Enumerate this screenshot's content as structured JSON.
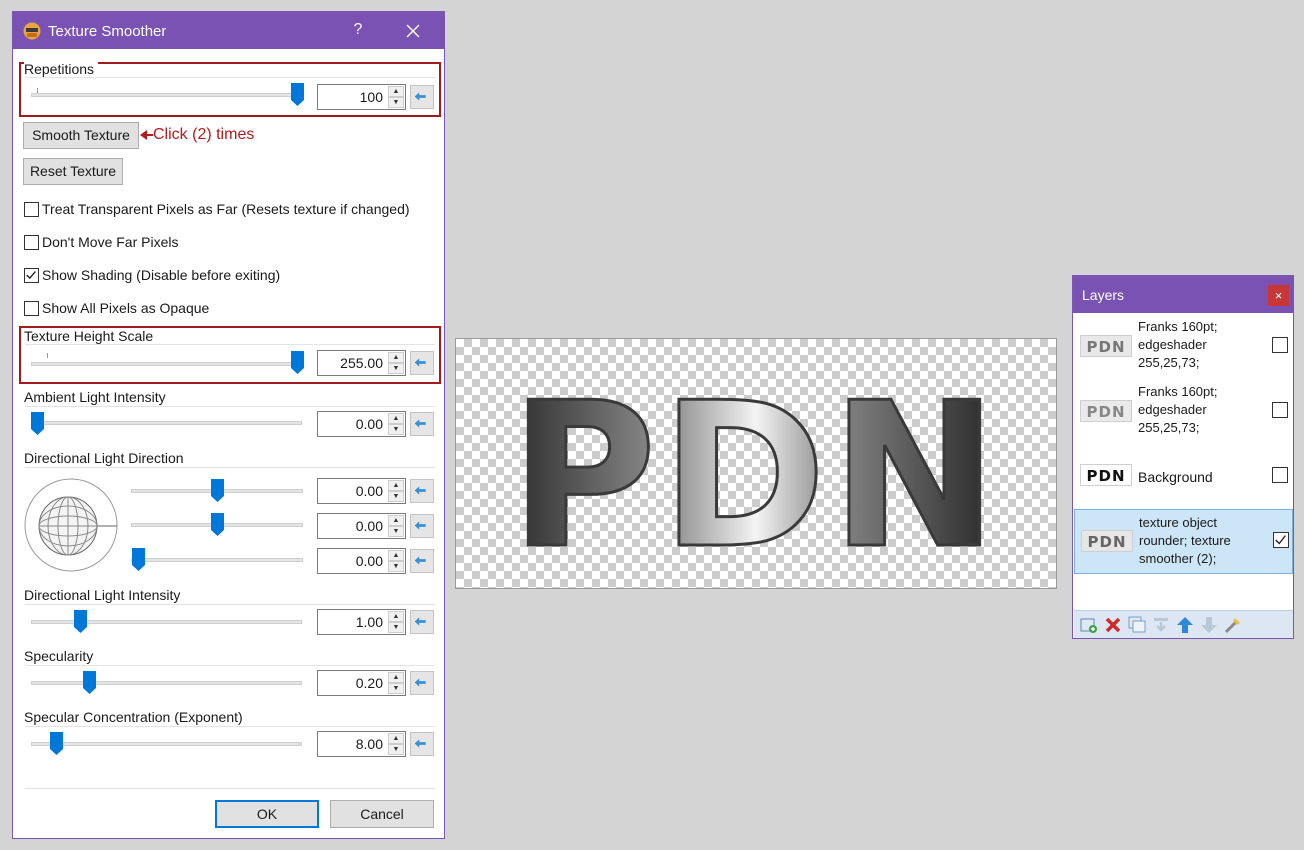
{
  "dialog": {
    "title": "Texture Smoother",
    "help_glyph": "?",
    "ok_label": "OK",
    "cancel_label": "Cancel"
  },
  "repetitions": {
    "label": "Repetitions",
    "value": "100",
    "slider_fraction": 1.0
  },
  "smooth_texture_label": "Smooth Texture",
  "annotation": "Click (2) times",
  "reset_texture_label": "Reset Texture",
  "checkboxes": [
    {
      "label": "Treat Transparent Pixels as Far (Resets texture if changed)",
      "checked": false
    },
    {
      "label": "Don't Move Far Pixels",
      "checked": false
    },
    {
      "label": "Show Shading (Disable before exiting)",
      "checked": true
    },
    {
      "label": "Show All Pixels as Opaque",
      "checked": false
    }
  ],
  "texture_height_scale": {
    "label": "Texture Height Scale",
    "value": "255.00",
    "slider_fraction": 1.0
  },
  "ambient_light": {
    "label": "Ambient Light Intensity",
    "value": "0.00",
    "slider_fraction": 0.0
  },
  "directional_light_direction": {
    "label": "Directional Light Direction",
    "values": [
      "0.00",
      "0.00",
      "0.00"
    ],
    "slider_fractions": [
      0.5,
      0.5,
      0.0
    ]
  },
  "directional_light_intensity": {
    "label": "Directional Light Intensity",
    "value": "1.00",
    "slider_fraction": 0.18
  },
  "specularity": {
    "label": "Specularity",
    "value": "0.20",
    "slider_fraction": 0.21
  },
  "specular_concentration": {
    "label": "Specular Concentration (Exponent)",
    "value": "8.00",
    "slider_fraction": 0.09
  },
  "canvas": {
    "text": "PDN"
  },
  "layers": {
    "title": "Layers",
    "close_glyph": "×",
    "items": [
      {
        "thumb": "PDN",
        "name_lines": [
          "Franks 160pt;",
          "edgeshader",
          "255,25,73;"
        ],
        "checked": false,
        "selected": false
      },
      {
        "thumb": "PDN",
        "name_lines": [
          "Franks 160pt;",
          "edgeshader",
          "255,25,73;"
        ],
        "checked": false,
        "selected": false
      },
      {
        "thumb": "PDN",
        "name_lines": [
          "Background"
        ],
        "checked": false,
        "selected": false
      },
      {
        "thumb": "PDN",
        "name_lines": [
          "texture object",
          "rounder; texture",
          "smoother (2);"
        ],
        "checked": true,
        "selected": true
      }
    ]
  },
  "colors": {
    "accent": "#7952b3",
    "highlight": "#a01b1b",
    "slider_thumb": "#0078d7",
    "selection": "#cde6f7"
  }
}
